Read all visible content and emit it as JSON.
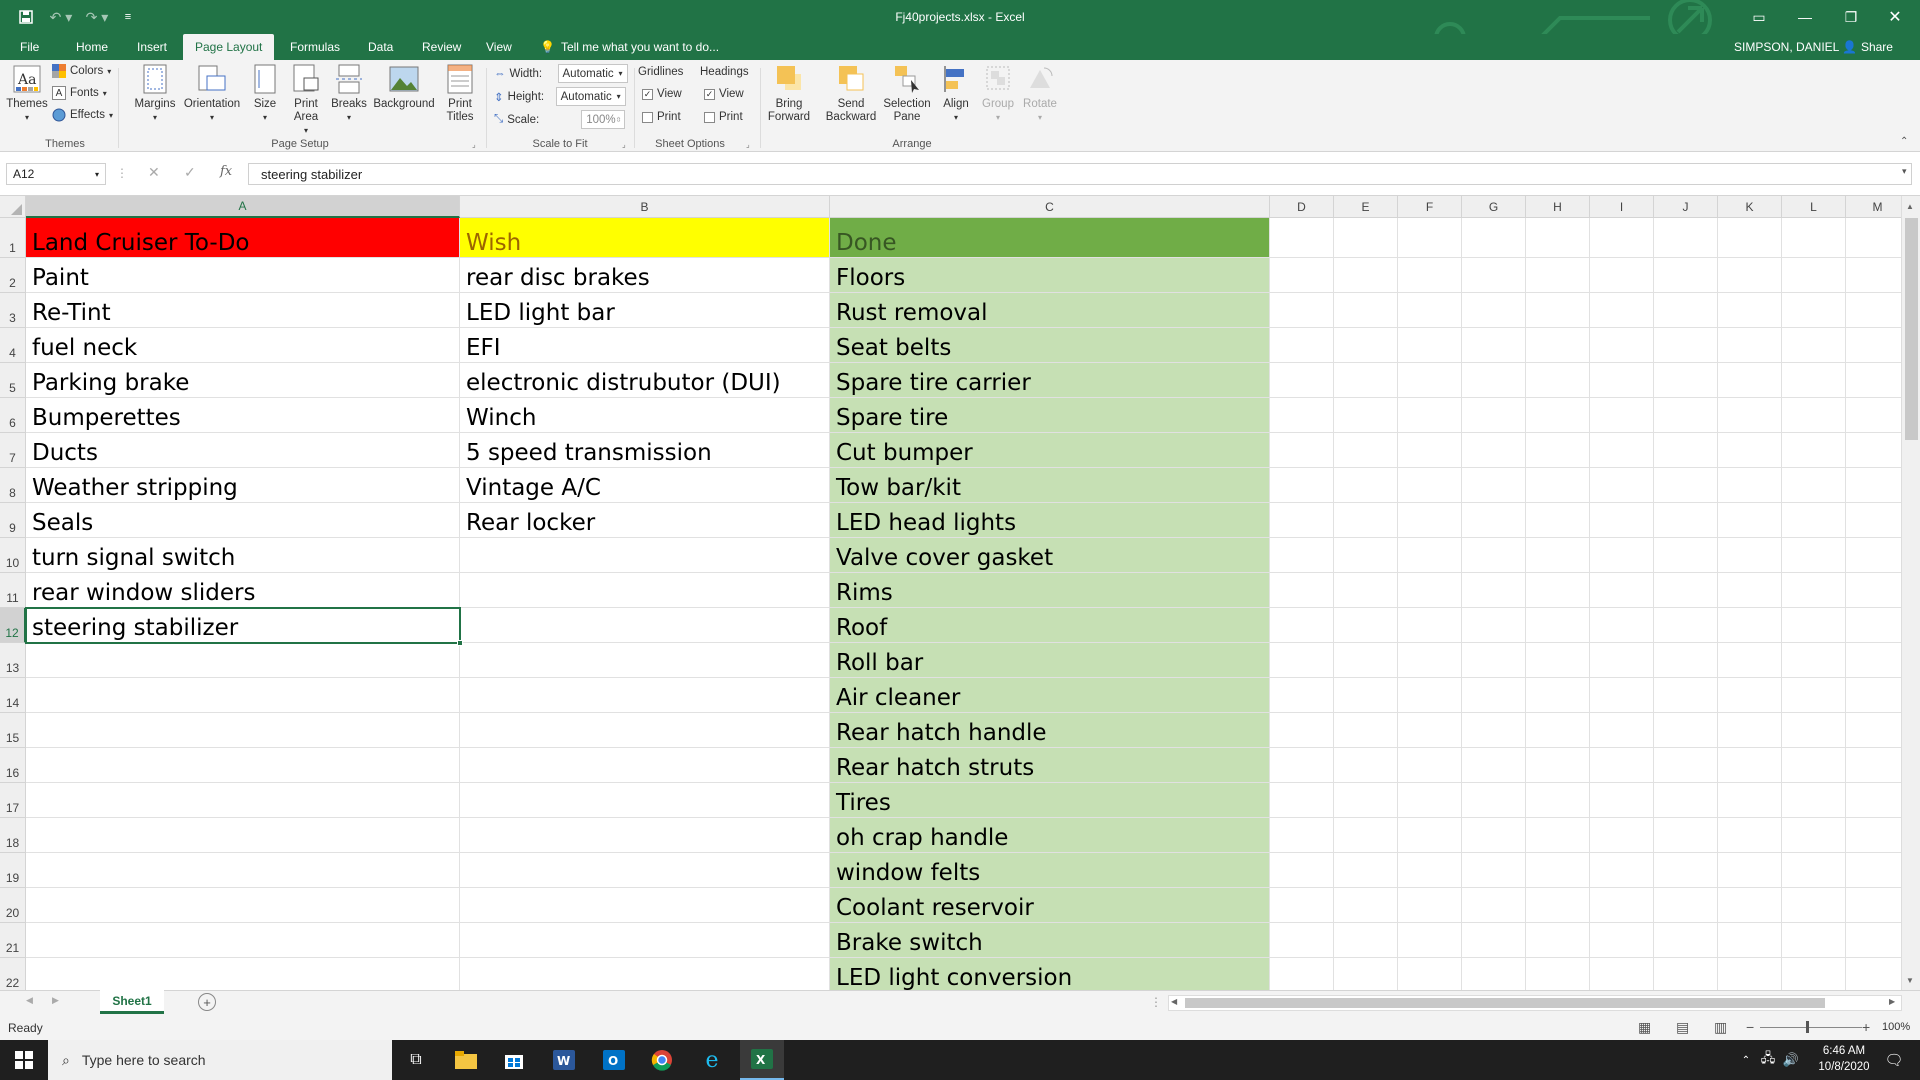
{
  "window": {
    "title": "Fj40projects.xlsx  -  Excel",
    "user": "SIMPSON, DANIEL",
    "share": "Share"
  },
  "tabs": [
    "File",
    "Home",
    "Insert",
    "Page Layout",
    "Formulas",
    "Data",
    "Review",
    "View"
  ],
  "tell_me": "Tell me what you want to do...",
  "ribbon": {
    "themes": {
      "themes": "Themes",
      "colors": "Colors",
      "fonts": "Fonts",
      "effects": "Effects",
      "group": "Themes"
    },
    "page_setup": {
      "margins": "Margins",
      "orientation": "Orientation",
      "size": "Size",
      "print_area": "Print Area",
      "breaks": "Breaks",
      "background": "Background",
      "print_titles": "Print Titles",
      "group": "Page Setup"
    },
    "scale": {
      "width_label": "Width:",
      "width_value": "Automatic",
      "height_label": "Height:",
      "height_value": "Automatic",
      "scale_label": "Scale:",
      "scale_value": "100%",
      "group": "Scale to Fit"
    },
    "sheet_options": {
      "gridlines": "Gridlines",
      "headings": "Headings",
      "view": "View",
      "print": "Print",
      "group": "Sheet Options"
    },
    "arrange": {
      "bring_forward": "Bring Forward",
      "send_backward": "Send Backward",
      "selection_pane": "Selection Pane",
      "align": "Align",
      "group_btn": "Group",
      "rotate": "Rotate",
      "group": "Arrange"
    }
  },
  "formula_bar": {
    "name_box": "A12",
    "content": "steering stabilizer",
    "fx": "fx"
  },
  "columns": [
    "A",
    "B",
    "C",
    "D",
    "E",
    "F",
    "G",
    "H",
    "I",
    "J",
    "K",
    "L",
    "M"
  ],
  "rows": [
    "1",
    "2",
    "3",
    "4",
    "5",
    "6",
    "7",
    "8",
    "9",
    "10",
    "11",
    "12",
    "13",
    "14",
    "15",
    "16",
    "17",
    "18",
    "19",
    "20",
    "21",
    "22"
  ],
  "headers": {
    "a": "Land Cruiser To-Do",
    "b": "Wish",
    "c": "Done"
  },
  "col_a": [
    "Paint",
    "Re-Tint",
    "fuel neck",
    "Parking brake",
    "Bumperettes",
    "Ducts",
    "Weather stripping",
    "Seals",
    "turn signal switch",
    "rear window sliders",
    "steering stabilizer"
  ],
  "col_b": [
    "rear disc brakes",
    "LED light bar",
    "EFI",
    "electronic distrubutor (DUI)",
    "Winch",
    "5 speed transmission",
    "Vintage A/C",
    "Rear locker"
  ],
  "col_c": [
    "Floors",
    "Rust removal",
    "Seat belts",
    "Spare tire carrier",
    "Spare tire",
    "Cut bumper",
    "Tow bar/kit",
    "LED head lights",
    "Valve cover gasket",
    "Rims",
    "Roof",
    "Roll bar",
    "Air cleaner",
    "Rear hatch handle",
    "Rear hatch struts",
    "Tires",
    "oh crap handle",
    "window felts",
    "Coolant reservoir",
    "Brake switch",
    "LED light conversion"
  ],
  "colors": {
    "header_a": "#ff0000",
    "header_b": "#ffff00",
    "header_c": "#70ad47",
    "done_fill": "#c6e0b4",
    "wish_text": "#9c6500",
    "done_text": "#375623",
    "accent": "#217346"
  },
  "sheet_tab": "Sheet1",
  "status": {
    "ready": "Ready",
    "zoom": "100%"
  },
  "taskbar": {
    "search": "Type here to search",
    "time": "6:46 AM",
    "date": "10/8/2020"
  }
}
